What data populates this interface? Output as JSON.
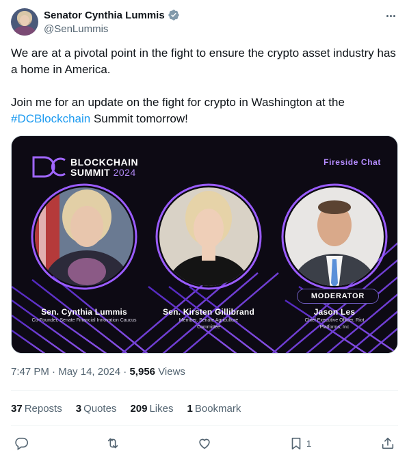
{
  "author": {
    "name": "Senator Cynthia Lummis",
    "handle": "@SenLummis",
    "verified": true
  },
  "tweet": {
    "line1": "We are at a pivotal point in the fight to ensure the crypto asset industry has a home in America.",
    "line2_prefix": "Join me for an update on the fight for crypto in Washington at the ",
    "hashtag": "#DCBlockchain",
    "line2_suffix": " Summit tomorrow!"
  },
  "media": {
    "event_line1": "BLOCKCHAIN",
    "event_line2": "SUMMIT",
    "event_year": "2024",
    "session": "Fireside Chat",
    "speakers": [
      {
        "name": "Sen. Cynthia Lummis",
        "role": "Co-Founder, Senate Financial Innovation Caucus"
      },
      {
        "name": "Sen. Kirsten Gillibrand",
        "role": "Member, Senate Agriculture Committee"
      },
      {
        "name": "Jason Les",
        "role": "Chief Executive Officer, Riot Platforms, Inc"
      }
    ],
    "moderator_label": "MODERATOR"
  },
  "meta": {
    "time": "7:47 PM",
    "date": "May 14, 2024",
    "views_count": "5,956",
    "views_label": "Views"
  },
  "stats": {
    "reposts_count": "37",
    "reposts_label": "Reposts",
    "quotes_count": "3",
    "quotes_label": "Quotes",
    "likes_count": "209",
    "likes_label": "Likes",
    "bookmarks_count": "1",
    "bookmarks_label": "Bookmark"
  },
  "actions": {
    "bookmark_count": "1"
  },
  "colors": {
    "accent": "#1d9bf0",
    "muted": "#536471",
    "text": "#0f1419",
    "media_purple": "#7b3fe4"
  }
}
